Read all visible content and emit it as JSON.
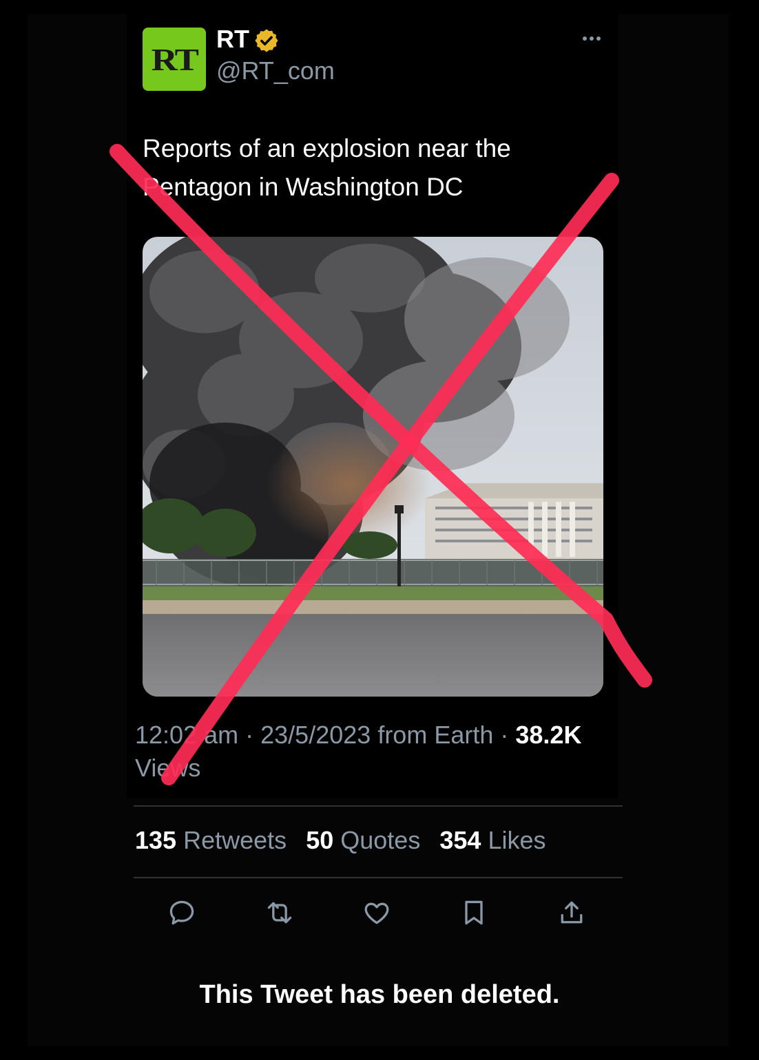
{
  "tweet": {
    "display_name": "RT",
    "handle": "@RT_com",
    "avatar_text": "RT",
    "text": "Reports of an explosion near the Pentagon in Washington DC",
    "meta": {
      "time": "12:02 am",
      "date": "23/5/2023",
      "source": "from Earth",
      "views_count": "38.2K",
      "views_label": "Views"
    },
    "stats": {
      "retweets_count": "135",
      "retweets_label": "Retweets",
      "quotes_count": "50",
      "quotes_label": "Quotes",
      "likes_count": "354",
      "likes_label": "Likes"
    }
  },
  "footer": {
    "deleted_notice": "This Tweet has been deleted."
  },
  "icons": {
    "verified": "verified-badge-icon",
    "more": "more-icon",
    "reply": "reply-icon",
    "retweet": "retweet-icon",
    "like": "heart-icon",
    "bookmark": "bookmark-icon",
    "share": "share-icon"
  },
  "colors": {
    "avatar_bg": "#77c81d",
    "verified_badge": "#e8b828",
    "overlay_x": "#ff2d55",
    "secondary_text": "#8b98a5"
  }
}
